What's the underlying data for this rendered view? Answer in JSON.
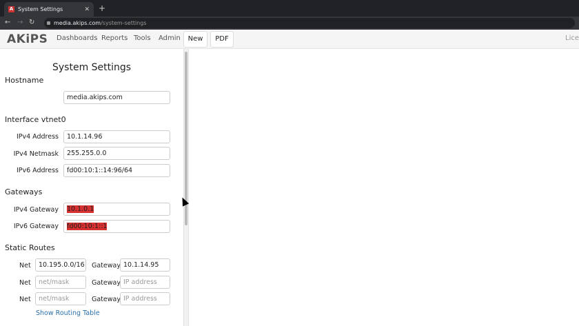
{
  "browser": {
    "tab_title": "System Settings",
    "url_host": "media.akips.com",
    "url_path": "/system-settings"
  },
  "header": {
    "logo": "AKiPS",
    "menu": [
      "Dashboards",
      "Reports",
      "Tools",
      "Admin"
    ],
    "new_label": "New",
    "pdf_label": "PDF",
    "license_label": "Lice"
  },
  "page": {
    "title": "System Settings",
    "hostname": {
      "heading": "Hostname",
      "value": "media.akips.com"
    },
    "interface": {
      "heading": "Interface vtnet0",
      "ipv4_label": "IPv4 Address",
      "ipv4": "10.1.14.96",
      "netmask_label": "IPv4 Netmask",
      "netmask": "255.255.0.0",
      "ipv6_label": "IPv6 Address",
      "ipv6": "fd00:10:1::14:96/64"
    },
    "gateways": {
      "heading": "Gateways",
      "ipv4_label": "IPv4 Gateway",
      "ipv4": "10.1.0.1",
      "ipv6_label": "IPv6 Gateway",
      "ipv6": "fd00:10:1::1"
    },
    "routes": {
      "heading": "Static Routes",
      "net_label": "Net",
      "gateway_label": "Gateway",
      "net_placeholder": "net/mask",
      "gateway_placeholder": "IP address",
      "rows": [
        {
          "net": "10.195.0.0/16",
          "gateway": "10.1.14.95"
        },
        {
          "net": "",
          "gateway": ""
        },
        {
          "net": "",
          "gateway": ""
        }
      ],
      "show_table": "Show Routing Table"
    }
  }
}
